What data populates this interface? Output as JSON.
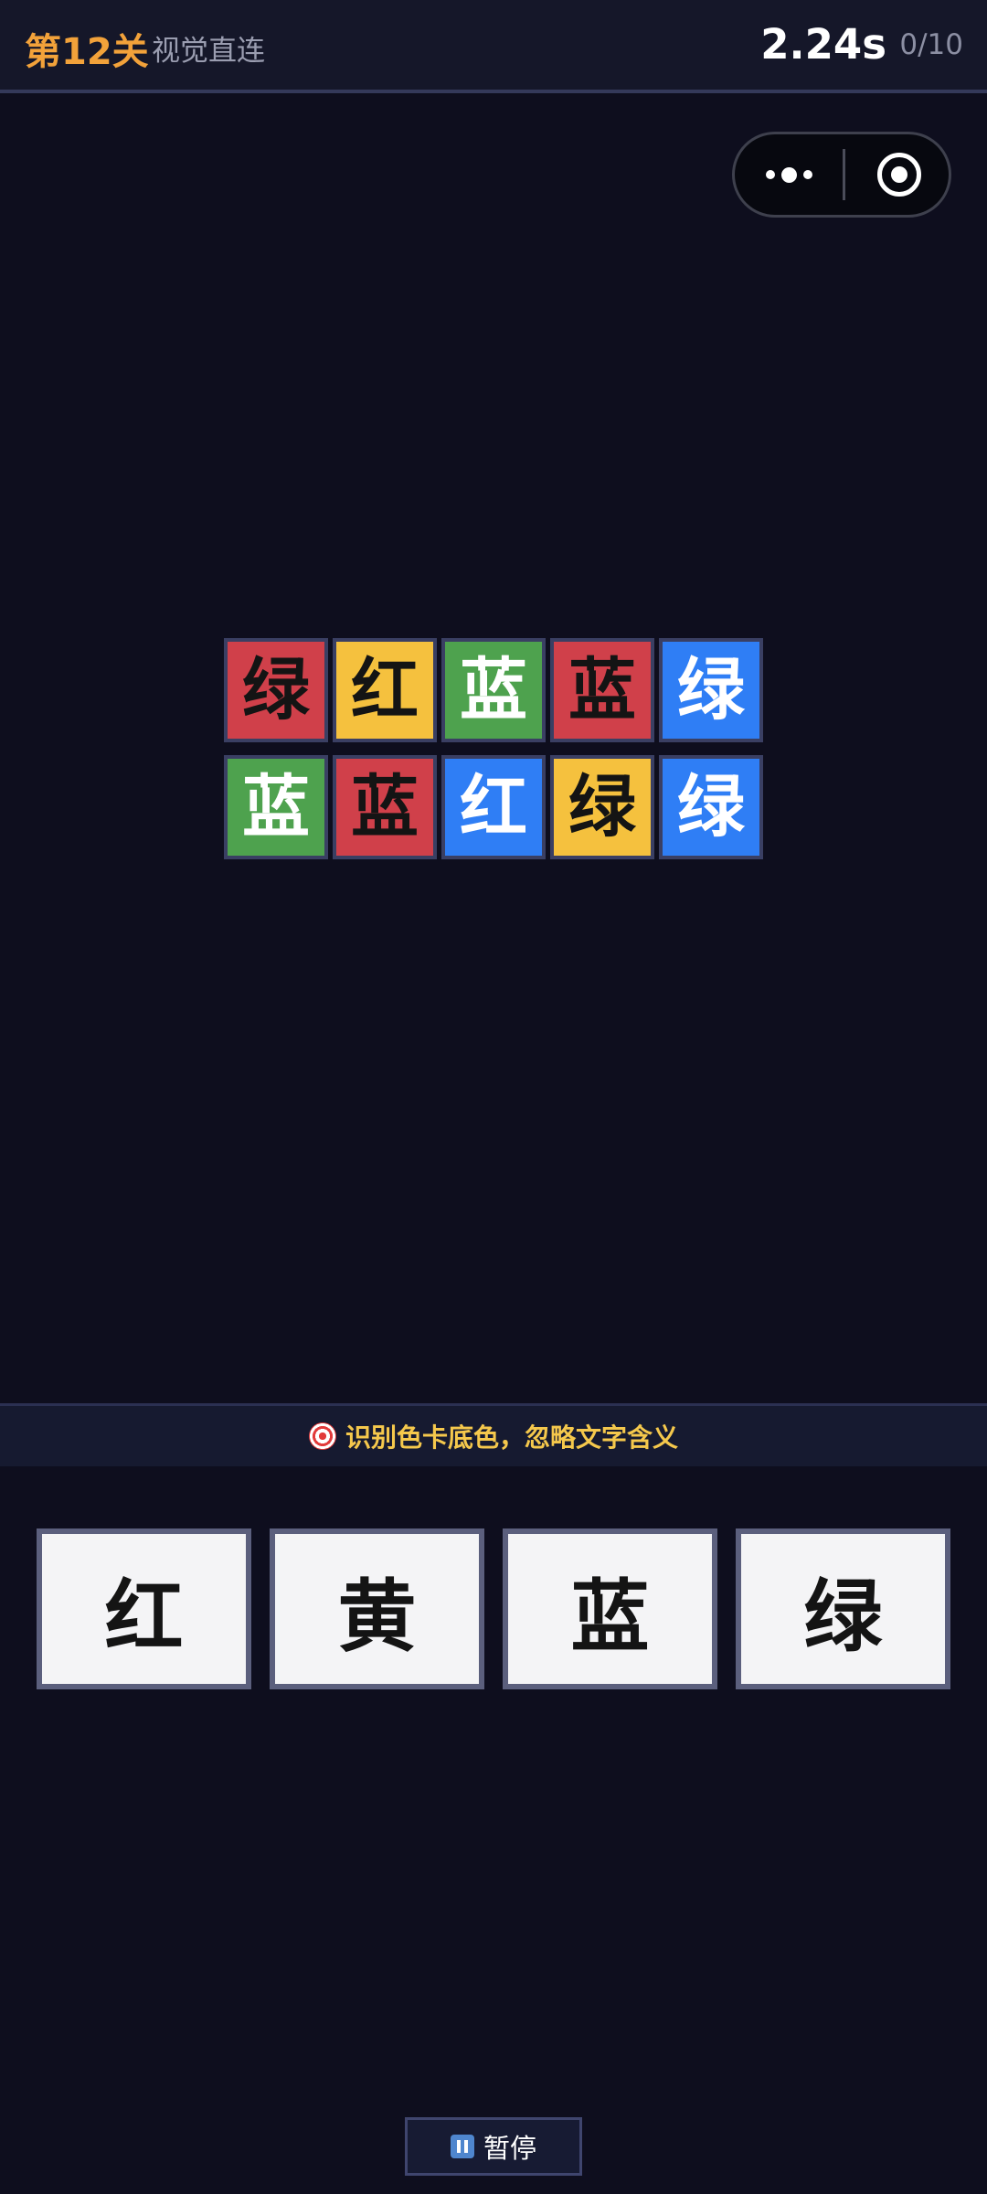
{
  "header": {
    "level": "第12关",
    "mode": "视觉直连",
    "timer": "2.24s",
    "progress": "0/10"
  },
  "colors": {
    "red": "#d0404a",
    "yellow": "#f5c13e",
    "green": "#4ea24e",
    "blue": "#2f7ef5",
    "text_dark": "#141414",
    "text_light": "#ffffff"
  },
  "cards": [
    {
      "text": "绿",
      "bg": "red",
      "fg": "dark"
    },
    {
      "text": "红",
      "bg": "yellow",
      "fg": "dark"
    },
    {
      "text": "蓝",
      "bg": "green",
      "fg": "light"
    },
    {
      "text": "蓝",
      "bg": "red",
      "fg": "dark"
    },
    {
      "text": "绿",
      "bg": "blue",
      "fg": "light"
    },
    {
      "text": "蓝",
      "bg": "green",
      "fg": "light"
    },
    {
      "text": "蓝",
      "bg": "red",
      "fg": "dark"
    },
    {
      "text": "红",
      "bg": "blue",
      "fg": "light"
    },
    {
      "text": "绿",
      "bg": "yellow",
      "fg": "dark"
    },
    {
      "text": "绿",
      "bg": "blue",
      "fg": "light"
    }
  ],
  "hint": {
    "icon": "target-icon",
    "text": "识别色卡底色，忽略文字含义"
  },
  "answers": [
    "红",
    "黄",
    "蓝",
    "绿"
  ],
  "pause": {
    "icon": "pause-icon",
    "label": "暂停"
  }
}
